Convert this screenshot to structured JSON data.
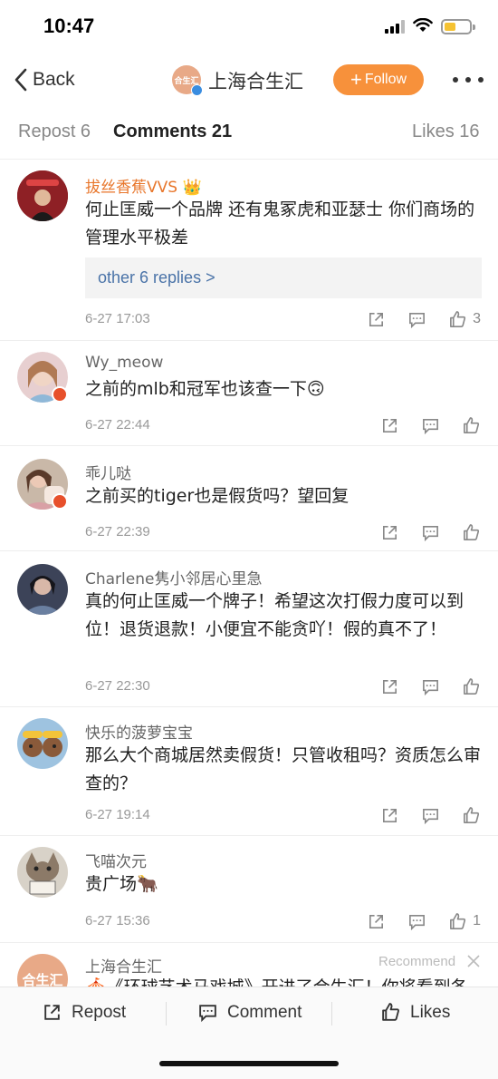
{
  "status": {
    "time": "10:47"
  },
  "nav": {
    "back_label": "Back",
    "avatar_text": "合生汇",
    "title": "上海合生汇",
    "follow_label": "Follow"
  },
  "tabs": {
    "repost": "Repost 6",
    "comments": "Comments 21",
    "likes": "Likes 16"
  },
  "accent_color": "#f7913b",
  "comments": [
    {
      "name": "拔丝香蕉VVS",
      "emoji": "👑",
      "text": "何止匡威一个品牌 还有鬼冢虎和亚瑟士 你们商场的管理水平极差",
      "replies": "other 6 replies >",
      "time": "6-27 17:03",
      "likes": "3"
    },
    {
      "name": "Wy_meow",
      "text": "之前的mlb和冠军也该查一下🙃",
      "time": "6-27 22:44",
      "likes": ""
    },
    {
      "name": "乖儿哒",
      "text": "之前买的tiger也是假货吗？望回复",
      "time": "6-27 22:39",
      "likes": ""
    },
    {
      "name": "Charlene隽小邻居心里急",
      "text": "真的何止匡威一个牌子！希望这次打假力度可以到位！退货退款！小便宜不能贪吖！假的真不了！",
      "time": "6-27 22:30",
      "likes": ""
    },
    {
      "name": "快乐的菠萝宝宝",
      "text": "那么大个商城居然卖假货！只管收租吗？资质怎么审查的？",
      "time": "6-27 19:14",
      "likes": ""
    },
    {
      "name": "飞喵次元",
      "text": "贵广场🐂",
      "time": "6-27 15:36",
      "likes": "1"
    },
    {
      "name": "上海合生汇",
      "avatar_text": "合生汇",
      "text": "🎪《环球艺术马戏城》开进了合生汇！你将看到各",
      "recommend": "Recommend"
    }
  ],
  "bottom_bar": {
    "repost": "Repost",
    "comment": "Comment",
    "likes": "Likes"
  }
}
